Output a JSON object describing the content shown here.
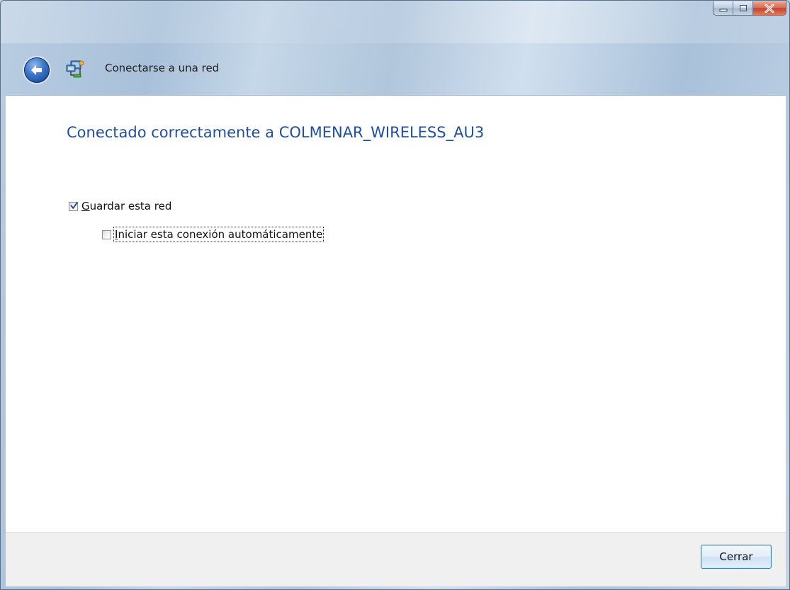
{
  "window": {
    "title": "Conectarse a una red"
  },
  "main": {
    "heading": "Conectado correctamente a COLMENAR_WIRELESS_AU3",
    "save_network": {
      "label_first": "G",
      "label_rest": "uardar esta red",
      "checked": true
    },
    "auto_connect": {
      "label_first": "I",
      "label_rest": "niciar esta conexión automáticamente",
      "checked": false
    }
  },
  "footer": {
    "close_label": "Cerrar"
  },
  "icons": {
    "back": "back-arrow-icon",
    "network": "network-icon",
    "minimize": "minimize-icon",
    "maximize": "maximize-icon",
    "close": "close-icon"
  },
  "colors": {
    "heading": "#1d4fa3",
    "close_caption": "#c6412a",
    "content_bg": "#ffffff",
    "footer_bg": "#f0f0f0"
  }
}
